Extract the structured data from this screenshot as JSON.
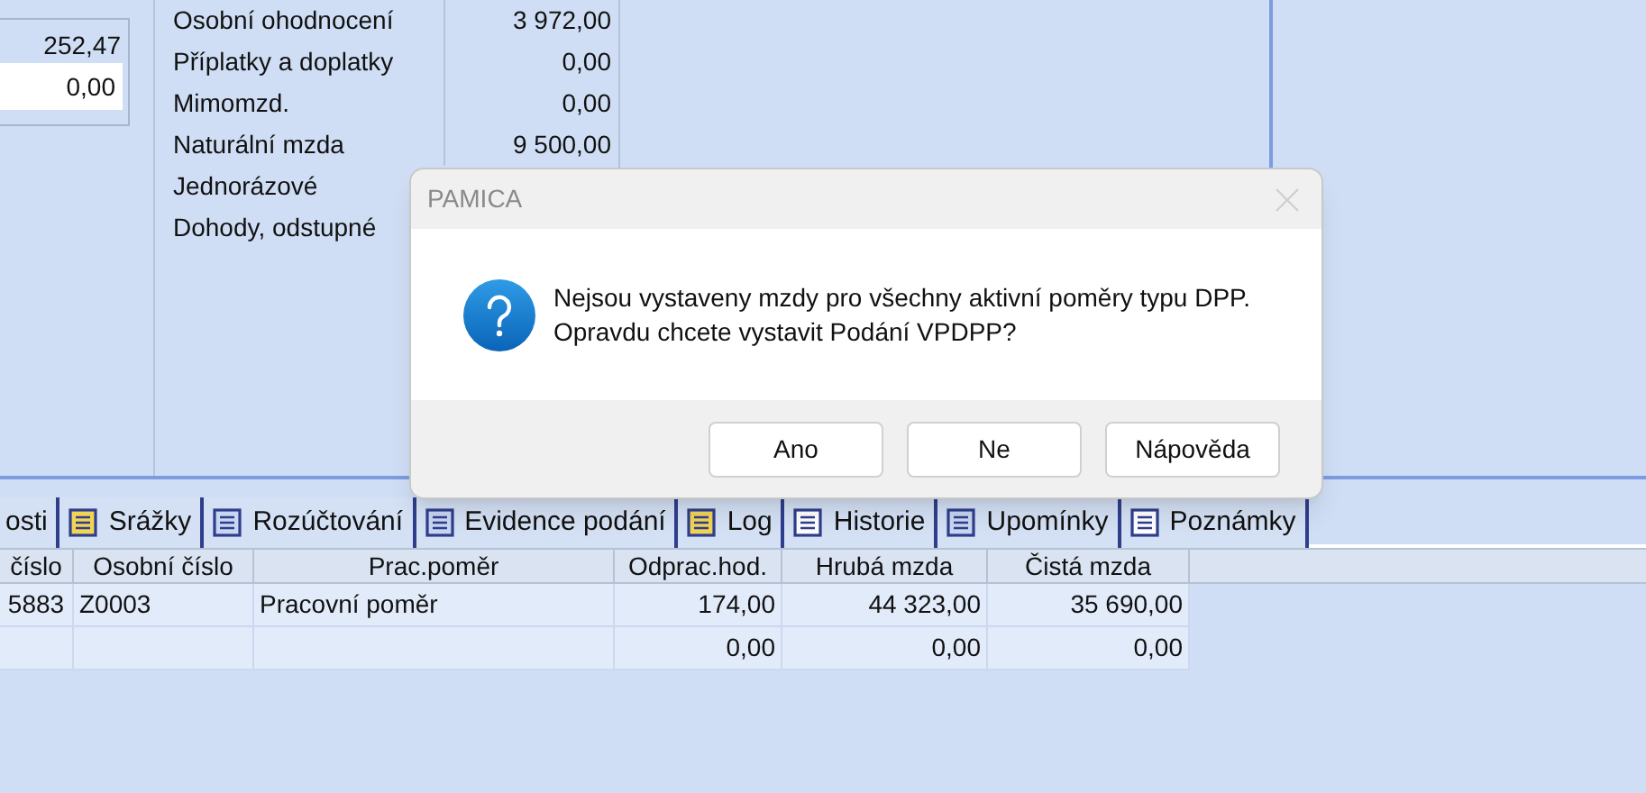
{
  "left_panel": {
    "value": "252,47",
    "input_value": "0,00"
  },
  "summary": [
    {
      "label": "Osobní ohodnocení",
      "value": "3 972,00"
    },
    {
      "label": "Příplatky a doplatky",
      "value": "0,00"
    },
    {
      "label": "Mimomzd.",
      "value": "0,00"
    },
    {
      "label": "Naturální mzda",
      "value": "9 500,00"
    },
    {
      "label": "Jednorázové"
    },
    {
      "label": "Dohody, odstupné"
    }
  ],
  "tabs": [
    {
      "label": "osti",
      "selected": false
    },
    {
      "label": "Srážky",
      "selected": false,
      "color": "#f2d455"
    },
    {
      "label": "Rozúčtování",
      "selected": false,
      "color": "#c9d6f2"
    },
    {
      "label": "Evidence podání",
      "selected": false,
      "color": "#c9d6f2"
    },
    {
      "label": "Log",
      "selected": false,
      "color": "#f2d455"
    },
    {
      "label": "Historie",
      "selected": false,
      "color": "#ffffff"
    },
    {
      "label": "Upomínky",
      "selected": false,
      "color": "#c9d6f2"
    },
    {
      "label": "Poznámky",
      "selected": false,
      "color": "#ffffff"
    }
  ],
  "table": {
    "columns": [
      "číslo",
      "Osobní číslo",
      "Prac.poměr",
      "Odprac.hod.",
      "Hrubá mzda",
      "Čistá mzda"
    ],
    "rows": [
      [
        "5883",
        "Z0003",
        "Pracovní poměr",
        "174,00",
        "44 323,00",
        "35 690,00"
      ],
      [
        "",
        "",
        "",
        "0,00",
        "0,00",
        "0,00"
      ]
    ]
  },
  "dialog": {
    "title": "PAMICA",
    "message": "Nejsou vystaveny mzdy pro všechny aktivní poměry typu DPP.\nOpravdu chcete vystavit Podání VPDPP?",
    "buttons": [
      "Ano",
      "Ne",
      "Nápověda"
    ]
  }
}
